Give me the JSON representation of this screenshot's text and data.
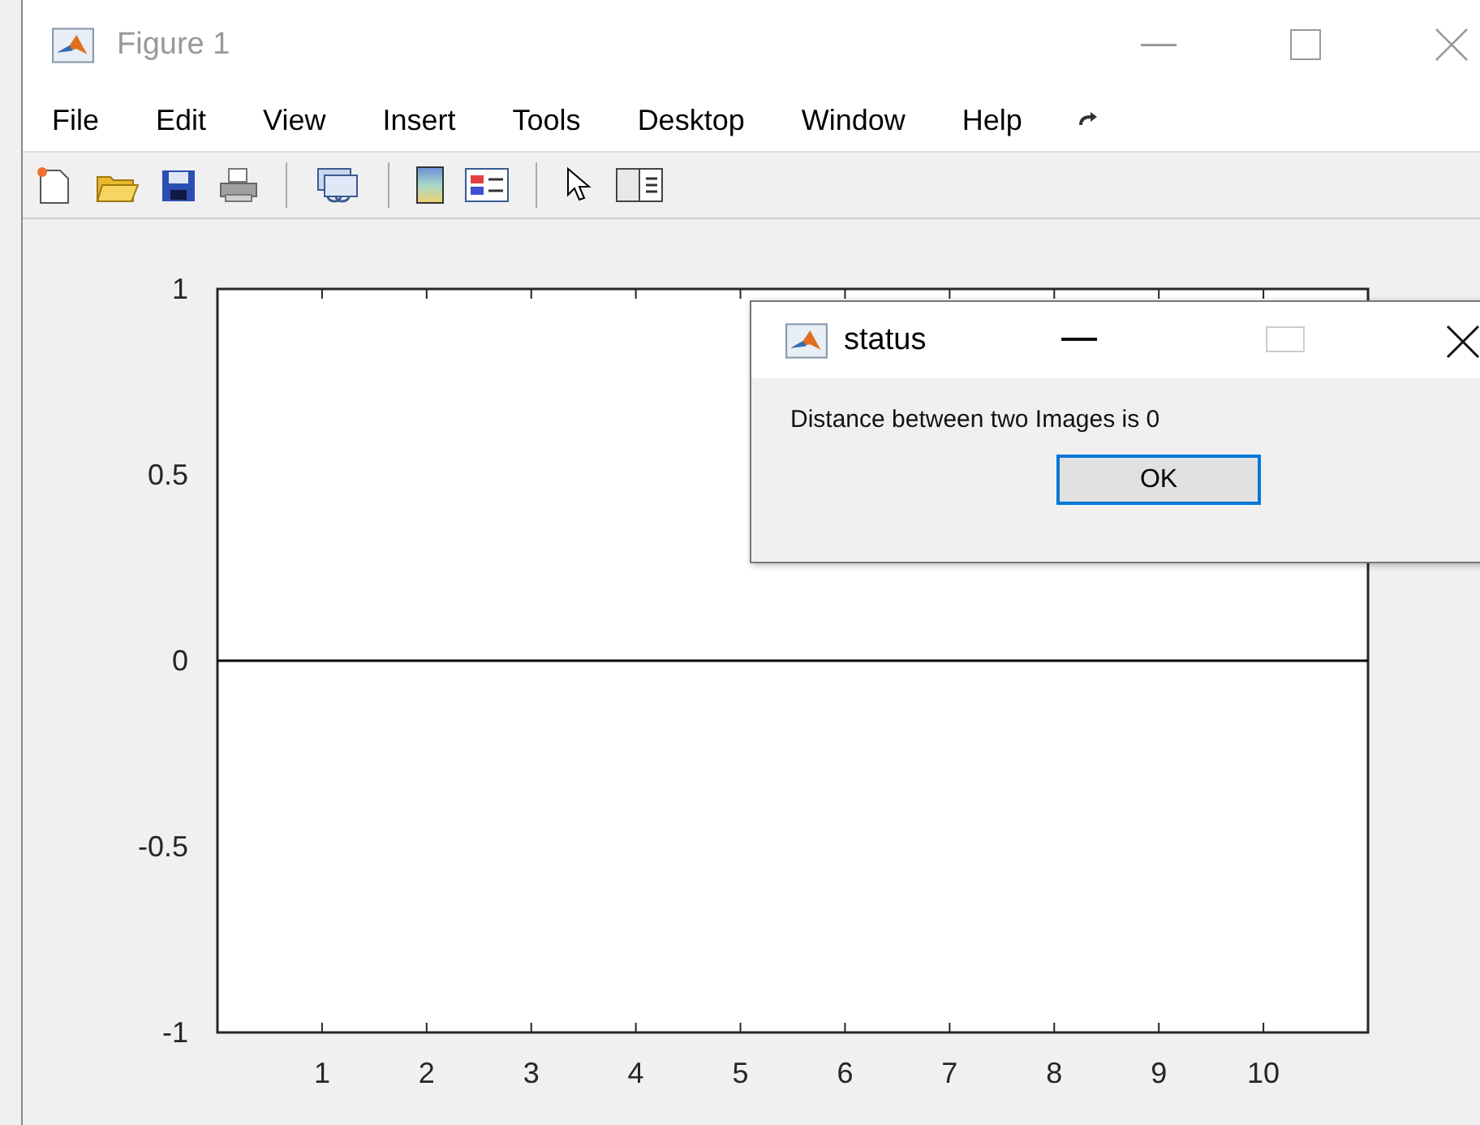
{
  "window": {
    "title": "Figure 1"
  },
  "menu": [
    "File",
    "Edit",
    "View",
    "Insert",
    "Tools",
    "Desktop",
    "Window",
    "Help"
  ],
  "figure": {
    "chart_data": {
      "type": "line",
      "x": [
        0,
        11
      ],
      "series": [
        {
          "color": "#000000",
          "values": [
            0,
            0
          ]
        }
      ],
      "xlim": [
        0,
        11
      ],
      "ylim": [
        -1,
        1
      ],
      "xticks": [
        1,
        2,
        3,
        4,
        5,
        6,
        7,
        8,
        9,
        10
      ],
      "yticks": [
        {
          "value": 1,
          "label": "1"
        },
        {
          "value": 0.5,
          "label": "0.5"
        },
        {
          "value": 0,
          "label": "0"
        },
        {
          "value": -0.5,
          "label": "-0.5"
        },
        {
          "value": -1,
          "label": "-1"
        }
      ]
    }
  },
  "dialog": {
    "title": "status",
    "message": "Distance between two Images is 0",
    "button": "OK"
  }
}
